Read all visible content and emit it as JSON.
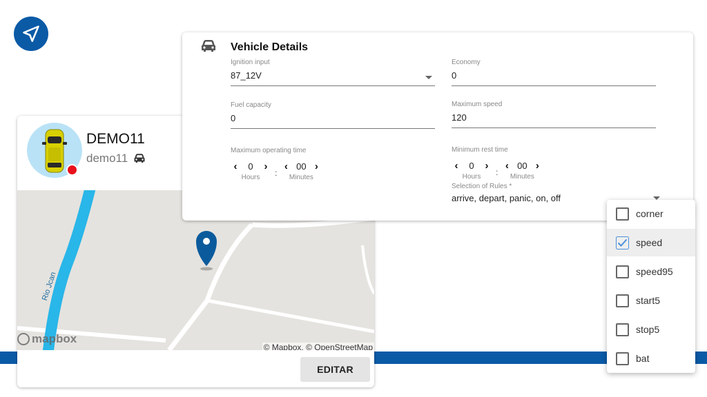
{
  "colors": {
    "brand": "#0a5aa6",
    "status_offline": "#e8101b",
    "river": "#29b6e8",
    "map_bg": "#e5e3df",
    "marker": "#0b5b9c"
  },
  "vehicle": {
    "name": "DEMO11",
    "plate": "demo11",
    "icon": "car-icon",
    "map": {
      "river_label": "Rio Jcan",
      "logo_text": "mapbox",
      "attribution": "© Mapbox, © OpenStreetMap"
    },
    "edit_label": "EDITAR"
  },
  "details": {
    "title": "Vehicle Details",
    "fields": {
      "ignition": {
        "label": "Ignition input",
        "value": "87_12V"
      },
      "economy": {
        "label": "Economy",
        "value": "0"
      },
      "fuel": {
        "label": "Fuel capacity",
        "value": "0"
      },
      "max_speed": {
        "label": "Maximum speed",
        "value": "120"
      },
      "rules": {
        "label": "Selection of Rules *",
        "value": "arrive, depart, panic, on, off"
      }
    },
    "max_operating": {
      "label": "Maximum operating time",
      "hours": "0",
      "minutes": "00",
      "hours_label": "Hours",
      "minutes_label": "Minutes",
      "separator": ":"
    },
    "min_rest": {
      "label": "Minimum rest time",
      "hours": "0",
      "minutes": "00",
      "hours_label": "Hours",
      "minutes_label": "Minutes",
      "separator": ":"
    }
  },
  "rules_dropdown": {
    "options": [
      {
        "label": "corner",
        "checked": false
      },
      {
        "label": "speed",
        "checked": true
      },
      {
        "label": "speed95",
        "checked": false
      },
      {
        "label": "start5",
        "checked": false
      },
      {
        "label": "stop5",
        "checked": false
      },
      {
        "label": "bat",
        "checked": false
      }
    ]
  }
}
